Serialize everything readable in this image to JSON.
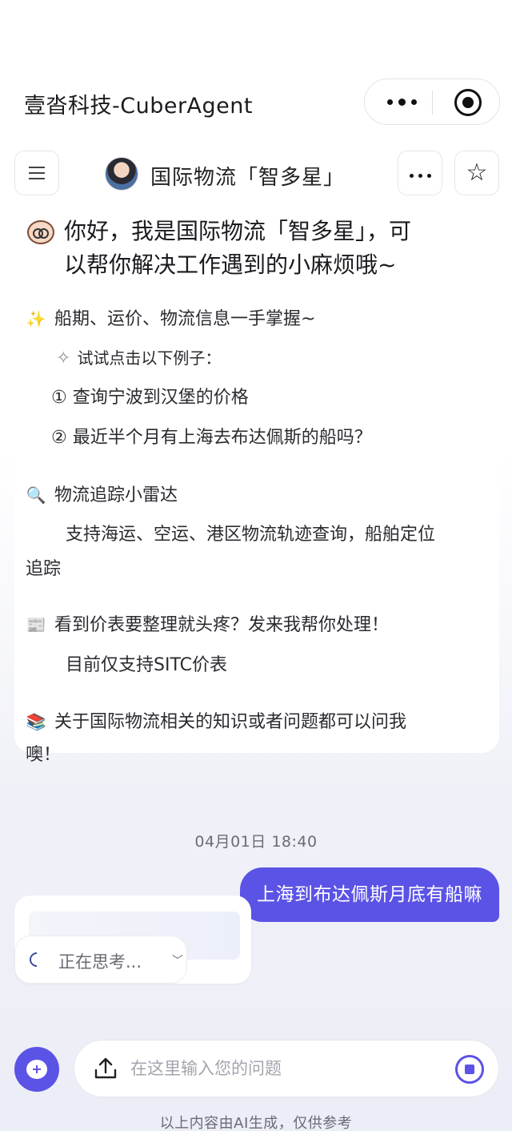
{
  "app": {
    "title": "壹沓科技-CuberAgent"
  },
  "agent": {
    "name": "国际物流「智多星」"
  },
  "welcome": {
    "greeting_line1": "你好，我是国际物流「智多星」，可",
    "greeting_line2": "以帮你解决工作遇到的小麻烦哦~",
    "section1_title": "船期、运价、物流信息一手掌握~",
    "examples_hint": "试试点击以下例子：",
    "example1": "① 查询宁波到汉堡的价格",
    "example2": "② 最近半个月有上海去布达佩斯的船吗？",
    "section2_title": "物流追踪小雷达",
    "section2_desc_line1": "支持海运、空运、港区物流轨迹查询，船舶定位",
    "section2_desc_line2": "追踪",
    "section3_title": "看到价表要整理就头疼？发来我帮你处理！",
    "section3_desc": "目前仅支持SITC价表",
    "section4_line1": "关于国际物流相关的知识或者问题都可以问我",
    "section4_line2": "噢！"
  },
  "chat": {
    "timestamp": "04月01日  18:40",
    "user_message": "上海到布达佩斯月底有船嘛",
    "thinking_label": "正在思考..."
  },
  "composer": {
    "placeholder": "在这里输入您的问题"
  },
  "footer": {
    "disclaimer": "以上内容由AI生成，仅供参考"
  },
  "icons": {
    "capsule_more": "more-dots-icon",
    "capsule_close": "target-icon",
    "menu": "menu-icon",
    "more": "ellipsis-icon",
    "favorite": "star-icon",
    "new_chat": "new-chat-icon",
    "upload": "upload-icon",
    "stop": "stop-icon"
  },
  "colors": {
    "accent": "#5b53e6",
    "text": "#1f1f24",
    "muted": "#6b6b78"
  }
}
